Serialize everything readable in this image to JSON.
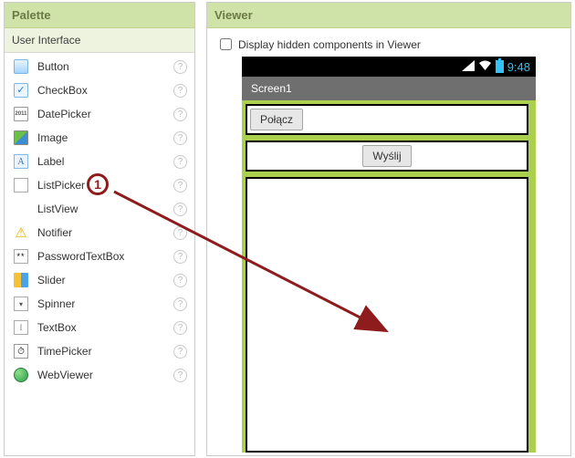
{
  "palette": {
    "title": "Palette",
    "category": "User Interface",
    "items": [
      {
        "label": "Button"
      },
      {
        "label": "CheckBox"
      },
      {
        "label": "DatePicker"
      },
      {
        "label": "Image"
      },
      {
        "label": "Label"
      },
      {
        "label": "ListPicker"
      },
      {
        "label": "ListView"
      },
      {
        "label": "Notifier"
      },
      {
        "label": "PasswordTextBox"
      },
      {
        "label": "Slider"
      },
      {
        "label": "Spinner"
      },
      {
        "label": "TextBox"
      },
      {
        "label": "TimePicker"
      },
      {
        "label": "WebViewer"
      }
    ],
    "help_symbol": "?"
  },
  "viewer": {
    "title": "Viewer",
    "display_hidden_label": "Display hidden components in Viewer",
    "display_hidden_checked": false,
    "phone": {
      "clock": "9:48",
      "screen_title": "Screen1",
      "button_connect": "Połącz",
      "button_send": "Wyślij"
    }
  },
  "annotation": {
    "number": "1"
  }
}
